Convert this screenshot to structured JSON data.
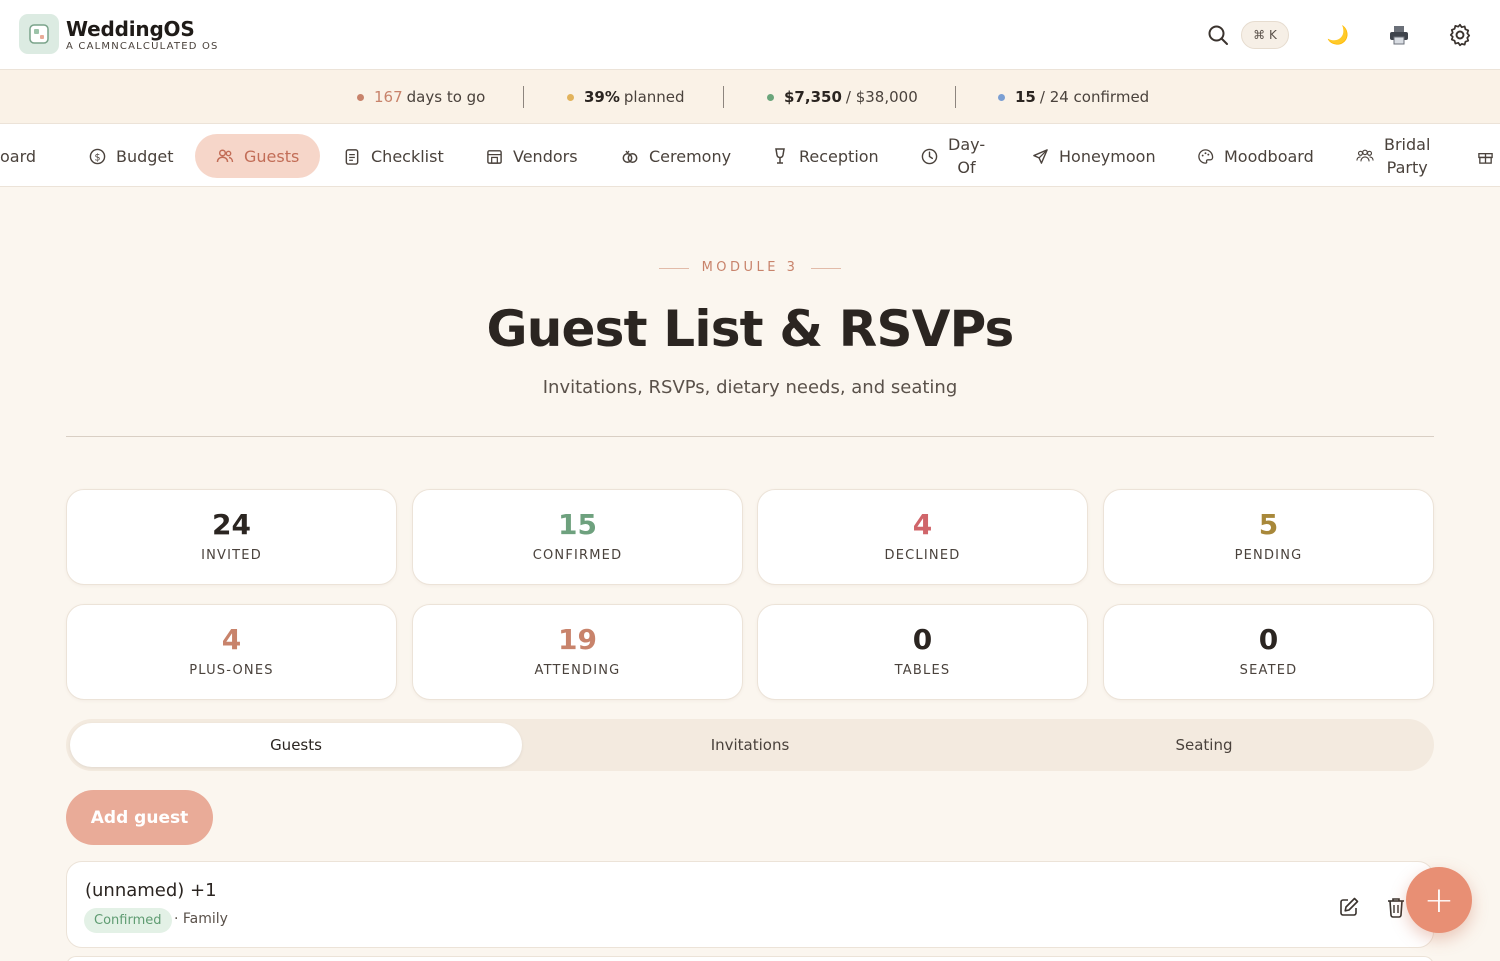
{
  "brand": {
    "name": "WeddingOS",
    "tagline": "A CALMNCALCULATED OS",
    "accent": "#e88f74"
  },
  "header": {
    "shortcut": "⌘ K",
    "moon_glyph": "🌙",
    "printer_glyph": "🖨"
  },
  "stats": {
    "days": {
      "value": "167",
      "text": "days to go",
      "dot": "#c8836b"
    },
    "planned": {
      "value": "39%",
      "text": "planned",
      "dot": "#e2b35c"
    },
    "budget": {
      "spent": "$7,350",
      "total": "/ $38,000",
      "dot": "#6aa57b"
    },
    "confirmed": {
      "value": "15",
      "text": "/ 24 confirmed",
      "dot": "#7b9fd3"
    }
  },
  "nav": {
    "items": [
      {
        "label": "oard"
      },
      {
        "label": "Budget"
      },
      {
        "label": "Guests",
        "active": true
      },
      {
        "label": "Checklist"
      },
      {
        "label": "Vendors"
      },
      {
        "label": "Ceremony"
      },
      {
        "label": "Reception"
      },
      {
        "label_line1": "Day-",
        "label_line2": "Of"
      },
      {
        "label": "Honeymoon"
      },
      {
        "label": "Moodboard"
      },
      {
        "label_line1": "Bridal",
        "label_line2": "Party"
      }
    ]
  },
  "page": {
    "module": "MODULE 3",
    "title": "Guest List & RSVPs",
    "subtitle": "Invitations, RSVPs, dietary needs, and seating"
  },
  "summary": [
    {
      "value": "24",
      "label": "INVITED",
      "color": "#2b2521"
    },
    {
      "value": "15",
      "label": "CONFIRMED",
      "color": "#6ea17e"
    },
    {
      "value": "4",
      "label": "DECLINED",
      "color": "#d0656a"
    },
    {
      "value": "5",
      "label": "PENDING",
      "color": "#a8883a"
    },
    {
      "value": "4",
      "label": "PLUS-ONES",
      "color": "#c8836b"
    },
    {
      "value": "19",
      "label": "ATTENDING",
      "color": "#c8836b"
    },
    {
      "value": "0",
      "label": "TABLES",
      "color": "#2b2521"
    },
    {
      "value": "0",
      "label": "SEATED",
      "color": "#2b2521"
    }
  ],
  "tabs": [
    {
      "label": "Guests",
      "active": true
    },
    {
      "label": "Invitations"
    },
    {
      "label": "Seating"
    }
  ],
  "actions": {
    "add_guest": "Add guest",
    "fab": "+"
  },
  "guests": [
    {
      "name": "(unnamed) +1",
      "status": "Confirmed",
      "group": "· Family"
    }
  ]
}
